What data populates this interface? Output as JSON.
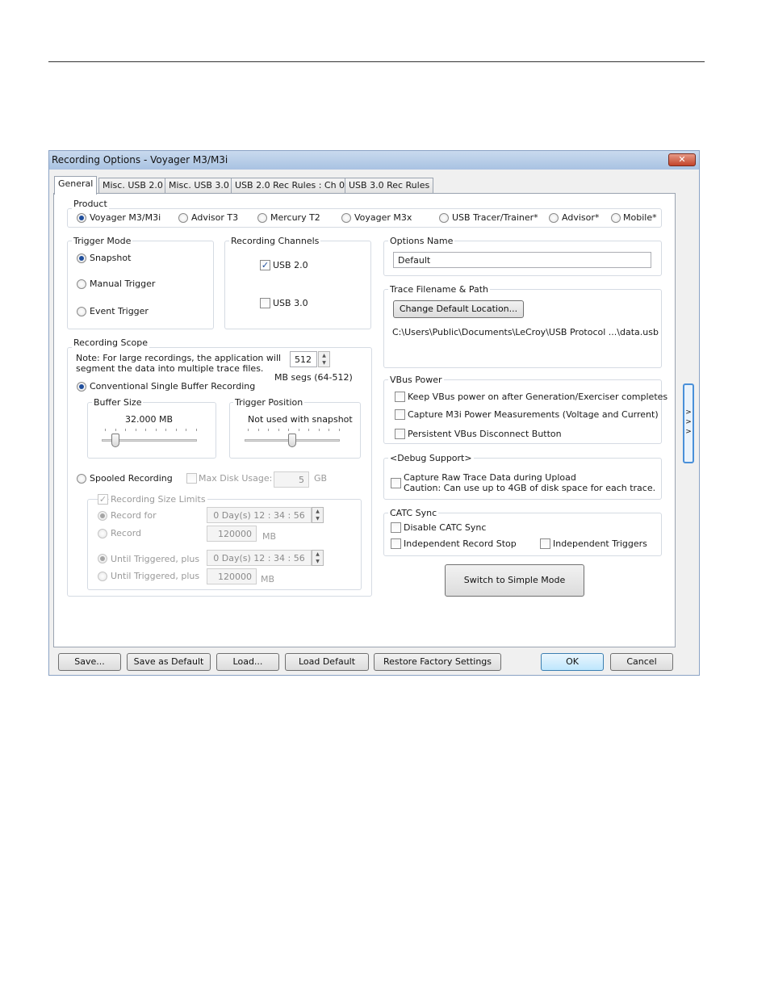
{
  "dialog": {
    "title": "Recording Options - Voyager M3/M3i",
    "close_glyph": "✕"
  },
  "tabs": [
    "General",
    "Misc. USB 2.0",
    "Misc. USB 3.0",
    "USB 2.0 Rec Rules : Ch 0",
    "USB 3.0 Rec Rules"
  ],
  "product": {
    "label": "Product",
    "options": [
      "Voyager M3/M3i",
      "Advisor T3",
      "Mercury T2",
      "Voyager M3x",
      "USB Tracer/Trainer*",
      "Advisor*",
      "Mobile*"
    ],
    "selected": "Voyager M3/M3i"
  },
  "trigger_mode": {
    "label": "Trigger Mode",
    "options": [
      "Snapshot",
      "Manual Trigger",
      "Event Trigger"
    ],
    "selected": "Snapshot"
  },
  "recording_channels": {
    "label": "Recording Channels",
    "usb20": {
      "label": "USB 2.0",
      "checked": true
    },
    "usb30": {
      "label": "USB 3.0",
      "checked": false
    }
  },
  "recording_scope": {
    "label": "Recording Scope",
    "note_line1": "Note: For large recordings, the application will",
    "note_line2": "segment the data into multiple trace files.",
    "segment_value": "512",
    "segment_unit": "MB segs (64-512)",
    "conventional_label": "Conventional Single Buffer Recording",
    "buffer_size_label": "Buffer Size",
    "buffer_size_value": "32.000 MB",
    "buffer_slider_level": 0.14,
    "trigger_position_label": "Trigger Position",
    "trigger_position_value": "Not used with snapshot",
    "trigger_slider_level": 0.5,
    "spooled_label": "Spooled Recording",
    "max_disk_label": "Max Disk Usage:",
    "max_disk_value": "5",
    "max_disk_unit": "GB",
    "size_limits_label": "Recording Size Limits",
    "record_for_label": "Record for",
    "record_for_value": "0 Day(s)  12 : 34 : 56",
    "record_label": "Record",
    "record_value": "120000",
    "record_unit": "MB",
    "until_triggered_label": "Until Triggered, plus",
    "until_triggered_time": "0 Day(s)  12 : 34 : 56",
    "until_triggered_label2": "Until Triggered, plus",
    "until_triggered_mb": "120000",
    "until_triggered_unit": "MB"
  },
  "options_name": {
    "label": "Options Name",
    "value": "Default"
  },
  "trace_filename": {
    "label": "Trace Filename & Path",
    "button": "Change Default Location...",
    "path": "C:\\Users\\Public\\Documents\\LeCroy\\USB Protocol ...\\data.usb"
  },
  "vbus_power": {
    "label": "VBus Power",
    "items": [
      "Keep VBus power on after Generation/Exerciser completes",
      "Capture M3i Power Measurements (Voltage and Current)",
      "Persistent VBus Disconnect Button"
    ]
  },
  "debug_support": {
    "label": "<Debug Support>",
    "line1": "Capture Raw Trace Data during Upload",
    "line2": "Caution: Can use up to 4GB of disk space for each trace."
  },
  "catc_sync": {
    "label": "CATC Sync",
    "disable": "Disable CATC Sync",
    "independent_stop": "Independent Record Stop",
    "independent_triggers": "Independent Triggers"
  },
  "switch_button": "Switch to Simple Mode",
  "side_tab_glyphs": [
    ">",
    ">",
    ">"
  ],
  "bottom_buttons": {
    "save": "Save...",
    "save_default": "Save as Default",
    "load": "Load...",
    "load_default": "Load Default",
    "restore": "Restore Factory Settings",
    "ok": "OK",
    "cancel": "Cancel"
  }
}
